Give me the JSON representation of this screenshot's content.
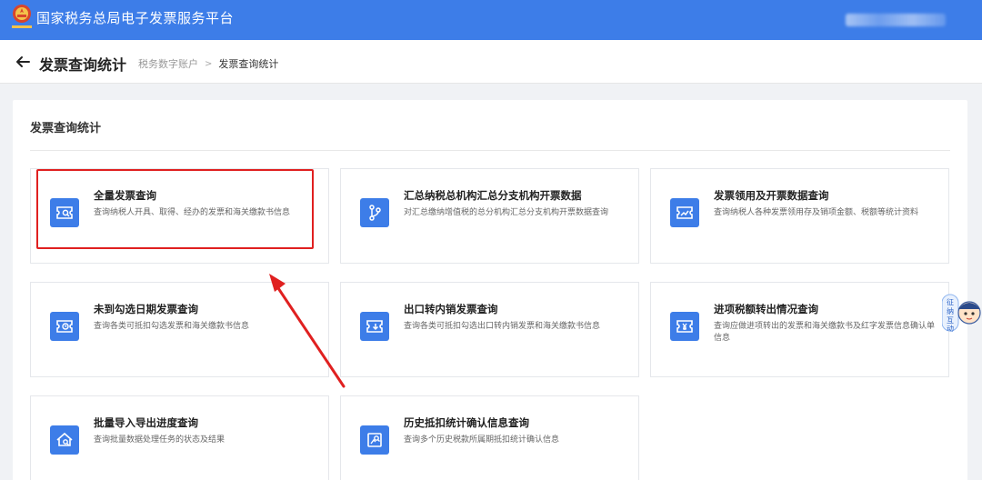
{
  "app": {
    "title": "国家税务总局电子发票服务平台"
  },
  "header": {
    "page_title": "发票查询统计",
    "breadcrumb": {
      "parent": "税务数字账户",
      "separator": ">",
      "current": "发票查询统计"
    }
  },
  "panel": {
    "title": "发票查询统计"
  },
  "cards": [
    {
      "title": "全量发票查询",
      "desc": "查询纳税人开具、取得、经办的发票和海关缴款书信息",
      "icon": "invoice-search-icon"
    },
    {
      "title": "汇总纳税总机构汇总分支机构开票数据",
      "desc": "对汇总缴纳增值税的总分机构汇总分支机构开票数据查询",
      "icon": "branch-icon"
    },
    {
      "title": "发票领用及开票数据查询",
      "desc": "查询纳税人各种发票领用存及销项金额、税额等统计资料",
      "icon": "invoice-trend-icon"
    },
    {
      "title": "未到勾选日期发票查询",
      "desc": "查询各类可抵扣勾选发票和海关缴款书信息",
      "icon": "invoice-clock-icon"
    },
    {
      "title": "出口转内销发票查询",
      "desc": "查询各类可抵扣勾选出口转内销发票和海关缴款书信息",
      "icon": "invoice-download-icon"
    },
    {
      "title": "进项税额转出情况查询",
      "desc": "查询应做进项转出的发票和海关缴款书及红字发票信息确认单信息",
      "icon": "invoice-yuan-icon"
    },
    {
      "title": "批量导入导出进度查询",
      "desc": "查询批量数据处理任务的状态及结果",
      "icon": "batch-progress-icon"
    },
    {
      "title": "历史抵扣统计确认信息查询",
      "desc": "查询多个历史税款所属期抵扣统计确认信息",
      "icon": "history-search-icon"
    }
  ],
  "mascot": {
    "label": "征纳互动"
  },
  "colors": {
    "brand": "#3d7de8",
    "highlight": "#e02020"
  }
}
